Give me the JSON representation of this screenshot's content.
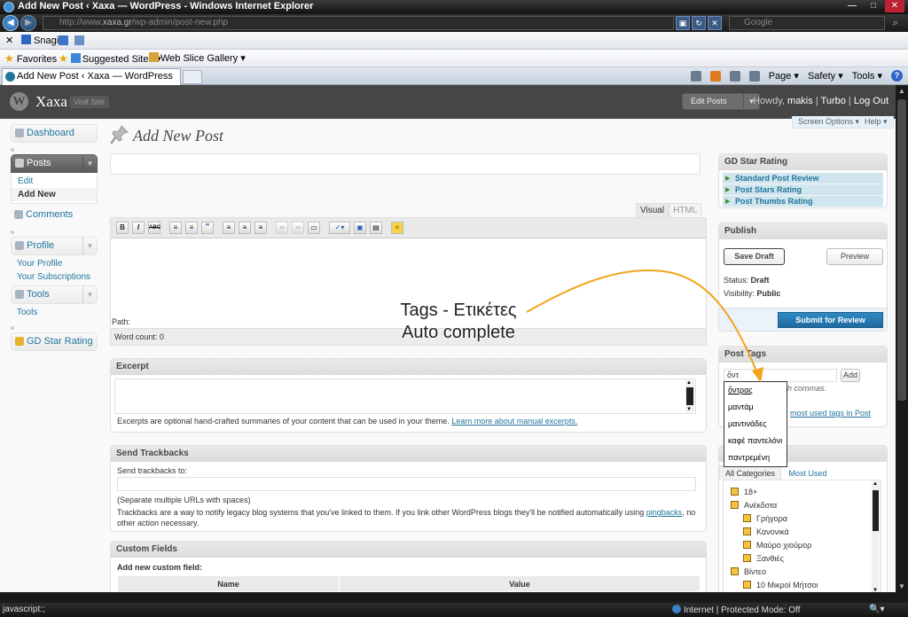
{
  "browser": {
    "window_title": "Add New Post ‹ Xaxa — WordPress - Windows Internet Explorer",
    "address_url_prefix": "http://www.",
    "address_url_domain": "xaxa.gr",
    "address_url_path": "/wp-admin/post-new.php",
    "search_placeholder": "Google",
    "snagit_label": "Snagit",
    "favorites_label": "Favorites",
    "suggested_sites_label": "Suggested Sites ▾",
    "web_slice_label": "Web Slice Gallery ▾",
    "tab_title": "Add New Post ‹ Xaxa — WordPress",
    "cmd_page": "Page ▾",
    "cmd_safety": "Safety ▾",
    "cmd_tools": "Tools ▾",
    "cmd_help": "?",
    "status_left": "javascript:;",
    "status_zone": "Internet | Protected Mode: Off",
    "status_zoom": "🔍▾"
  },
  "wp_header": {
    "site_name": "Xaxa",
    "visit_site": "Visit Site",
    "edit_posts": "Edit Posts",
    "howdy": "Howdy,",
    "user": "makis",
    "sep1": " | ",
    "turbo": "Turbo",
    "sep2": " | ",
    "logout": "Log Out",
    "screen_options": "Screen Options ▾",
    "help": "Help ▾"
  },
  "menu": {
    "dashboard": "Dashboard",
    "posts": "Posts",
    "posts_edit": "Edit",
    "posts_add_new": "Add New",
    "comments": "Comments",
    "profile": "Profile",
    "your_profile": "Your Profile",
    "your_subscriptions": "Your Subscriptions",
    "tools": "Tools",
    "tools_sub": "Tools",
    "gd_star": "GD Star Rating"
  },
  "main": {
    "page_title": "Add New Post",
    "tab_visual": "Visual",
    "tab_html": "HTML",
    "path_label": "Path:",
    "word_count": "Word count: 0",
    "excerpt_title": "Excerpt",
    "excerpt_help": "Excerpts are optional hand-crafted summaries of your content that can be used in your theme.",
    "excerpt_link": "Learn more about manual excerpts.",
    "trackbacks_title": "Send Trackbacks",
    "trackbacks_label": "Send trackbacks to:",
    "trackbacks_sep": "(Separate multiple URLs with spaces)",
    "trackbacks_help_1": "Trackbacks are a way to notify legacy blog systems that you've linked to them. If you link other WordPress blogs they'll be notified automatically using",
    "trackbacks_help_link": "pingbacks",
    "trackbacks_help_2": ", no other action necessary.",
    "custom_fields_title": "Custom Fields",
    "add_custom_field": "Add new custom field:",
    "cf_name": "Name",
    "cf_value": "Value"
  },
  "sidebar": {
    "gd_title": "GD Star Rating",
    "gd_items": [
      "Standard Post Review",
      "Post Stars Rating",
      "Post Thumbs Rating"
    ],
    "publish_title": "Publish",
    "save_draft": "Save Draft",
    "preview": "Preview",
    "status_label": "Status:",
    "status_value": "Draft",
    "visibility_label": "Visibility:",
    "visibility_value": "Public",
    "submit_review": "Submit for Review",
    "tags_title": "Post Tags",
    "tags_input_value": "ὄντ",
    "tags_add": "Add",
    "tags_commas": "h commas.",
    "tags_most_used": "most used tags in Post",
    "autocomplete": [
      "ὄντρας",
      "μαντάμ",
      "μαντινάδες",
      "καφέ παντελόνι",
      "παντρεμένη"
    ],
    "cat_tab_all": "All Categories",
    "cat_tab_most": "Most Used",
    "categories": [
      "18+",
      "Ανέκδοτα",
      "Γρήγορα",
      "Κανονικά",
      "Μαύρο χιούμορ",
      "Ξανθιές",
      "Βίντεο",
      "10 Μικροί Μήτσοι"
    ]
  },
  "annotation": {
    "line1": "Tags - Ετικέτες",
    "line2": "Auto complete"
  },
  "colors": {
    "wp_header": "#464646",
    "link": "#21759b",
    "primary_button": "#2e8ac2",
    "annotation_arrow": "#f3a41e"
  }
}
